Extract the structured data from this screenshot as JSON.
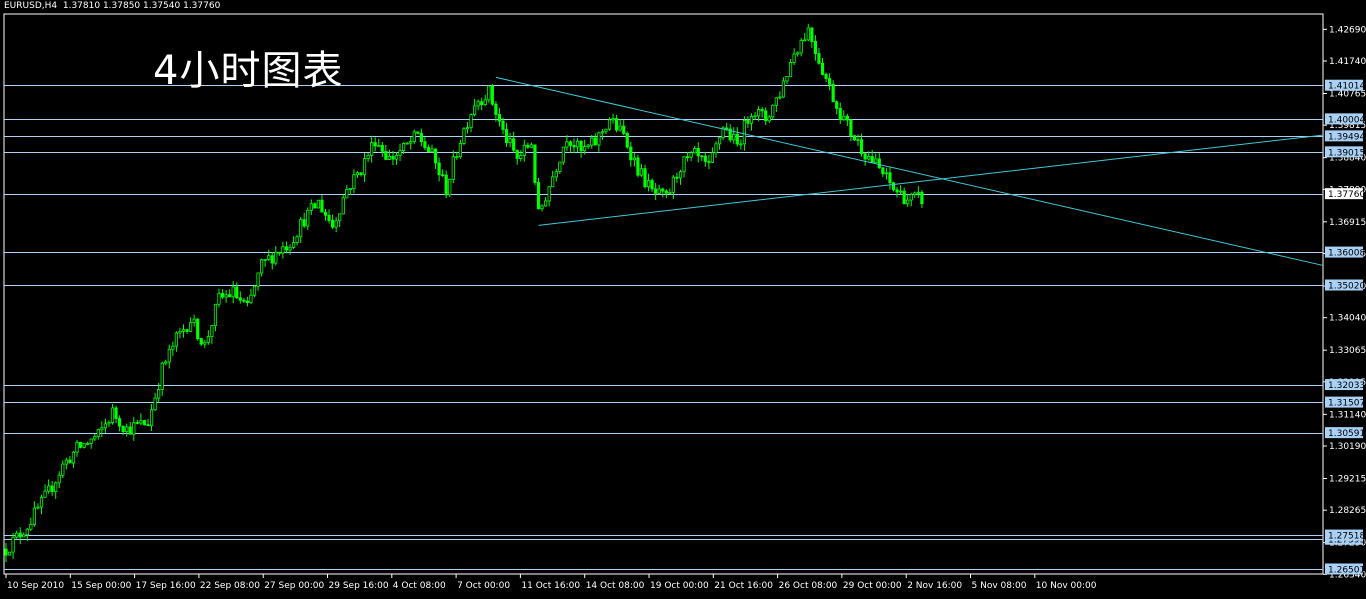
{
  "header": {
    "symbol": "EURUSD,H4",
    "ohlc": "1.37810 1.37850 1.37540 1.37760"
  },
  "annotation": "4小时图表",
  "colors": {
    "background": "#000000",
    "candle": "#00ff00",
    "level_line": "#a9d0f5",
    "trend_line": "#40c8d8",
    "price_box": "#a9d0f5",
    "axis_text": "#ffffff"
  },
  "chart_data": {
    "type": "candlestick",
    "symbol": "EURUSD",
    "timeframe": "H4",
    "x_tick_labels": [
      "10 Sep 2010",
      "15 Sep 00:00",
      "17 Sep 16:00",
      "22 Sep 08:00",
      "27 Sep 00:00",
      "29 Sep 16:00",
      "4 Oct 08:00",
      "7 Oct 00:00",
      "11 Oct 16:00",
      "14 Oct 08:00",
      "19 Oct 00:00",
      "21 Oct 16:00",
      "26 Oct 08:00",
      "29 Oct 00:00",
      "2 Nov 16:00",
      "5 Nov 08:00",
      "10 Nov 00:00"
    ],
    "y_ticks": [
      1.4269,
      1.4174,
      1.40765,
      1.39815,
      1.3884,
      1.3789,
      1.36915,
      1.35965,
      1.3499,
      1.3404,
      1.33065,
      1.32115,
      1.3114,
      1.3019,
      1.29215,
      1.28265,
      1.2729,
      1.2634
    ],
    "y_tick_labels": [
      "1.42690",
      "1.41740",
      "1.40765",
      "1.39815",
      "1.38840",
      "1.37890",
      "1.36915",
      "1.35965",
      "1.34990",
      "1.34040",
      "1.33065",
      "1.32115",
      "1.31140",
      "1.30190",
      "1.29215",
      "1.28265",
      "1.27290",
      "1.26340"
    ],
    "ylim": [
      1.2635,
      1.4315
    ],
    "horizontal_levels": [
      {
        "value": 1.41014,
        "label": "1.41014"
      },
      {
        "value": 1.40004,
        "label": "1.40004"
      },
      {
        "value": 1.39494,
        "label": "1.39494"
      },
      {
        "value": 1.39015,
        "label": "1.39015"
      },
      {
        "value": 1.3776,
        "label": "1.37760"
      },
      {
        "value": 1.36008,
        "label": "1.36008"
      },
      {
        "value": 1.3502,
        "label": "1.35020"
      },
      {
        "value": 1.32033,
        "label": "1.32033"
      },
      {
        "value": 1.31507,
        "label": "1.31507"
      },
      {
        "value": 1.30591,
        "label": "1.30591"
      },
      {
        "value": 1.27393,
        "label": "1.27393"
      },
      {
        "value": 1.27518,
        "label": "1.27518"
      },
      {
        "value": 1.26501,
        "label": "1.26501"
      }
    ],
    "current_price_index": 4,
    "trend_lines": [
      {
        "from": {
          "bar": 138,
          "price": 1.4125
        },
        "to": {
          "bar": 292,
          "price": 1.3752
        }
      },
      {
        "from": {
          "bar": 150,
          "price": 1.3681
        },
        "to": {
          "bar": 292,
          "price": 1.3855
        }
      }
    ],
    "close_path": [
      [
        0,
        1.271
      ],
      [
        6,
        1.278
      ],
      [
        12,
        1.288
      ],
      [
        16,
        1.296
      ],
      [
        20,
        1.301
      ],
      [
        26,
        1.305
      ],
      [
        30,
        1.312
      ],
      [
        34,
        1.307
      ],
      [
        40,
        1.309
      ],
      [
        44,
        1.325
      ],
      [
        48,
        1.334
      ],
      [
        52,
        1.34
      ],
      [
        56,
        1.332
      ],
      [
        60,
        1.346
      ],
      [
        64,
        1.348
      ],
      [
        68,
        1.343
      ],
      [
        72,
        1.356
      ],
      [
        76,
        1.36
      ],
      [
        80,
        1.363
      ],
      [
        84,
        1.37
      ],
      [
        88,
        1.375
      ],
      [
        92,
        1.368
      ],
      [
        96,
        1.379
      ],
      [
        100,
        1.385
      ],
      [
        104,
        1.394
      ],
      [
        108,
        1.388
      ],
      [
        112,
        1.391
      ],
      [
        116,
        1.395
      ],
      [
        120,
        1.389
      ],
      [
        124,
        1.379
      ],
      [
        128,
        1.394
      ],
      [
        132,
        1.405
      ],
      [
        136,
        1.408
      ],
      [
        140,
        1.396
      ],
      [
        144,
        1.388
      ],
      [
        148,
        1.393
      ],
      [
        150,
        1.371
      ],
      [
        154,
        1.383
      ],
      [
        158,
        1.395
      ],
      [
        162,
        1.39
      ],
      [
        166,
        1.393
      ],
      [
        170,
        1.4
      ],
      [
        174,
        1.395
      ],
      [
        178,
        1.385
      ],
      [
        182,
        1.378
      ],
      [
        186,
        1.376
      ],
      [
        190,
        1.386
      ],
      [
        194,
        1.389
      ],
      [
        198,
        1.385
      ],
      [
        202,
        1.398
      ],
      [
        206,
        1.392
      ],
      [
        210,
        1.403
      ],
      [
        214,
        1.4
      ],
      [
        218,
        1.408
      ],
      [
        222,
        1.42
      ],
      [
        226,
        1.427
      ],
      [
        230,
        1.415
      ],
      [
        234,
        1.404
      ],
      [
        238,
        1.396
      ],
      [
        242,
        1.39
      ],
      [
        246,
        1.385
      ],
      [
        250,
        1.379
      ],
      [
        254,
        1.376
      ],
      [
        258,
        1.376
      ]
    ]
  }
}
